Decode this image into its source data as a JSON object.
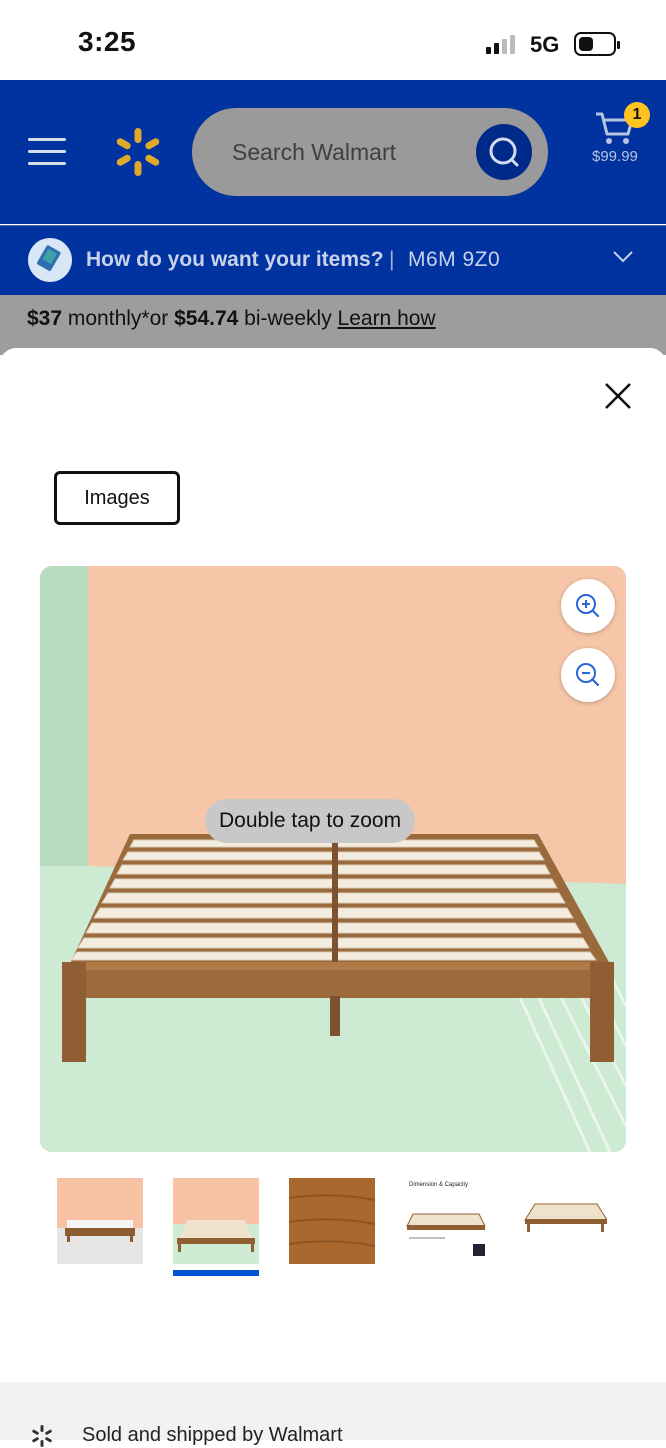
{
  "status_bar": {
    "time": "3:25",
    "network": "5G"
  },
  "header": {
    "search_placeholder": "Search Walmart",
    "cart_count": "1",
    "cart_total": "$99.99",
    "brand_color": "#0033a0",
    "spark_color": "#ffc220"
  },
  "pickup": {
    "question": "How do you want your items?",
    "separator": "|",
    "postal_code": "M6M 9Z0"
  },
  "finance": {
    "monthly_amount": "$37",
    "monthly_text": " monthly*or ",
    "biweekly_amount": "$54.74",
    "biweekly_text": " bi-weekly ",
    "link": "Learn how"
  },
  "viewer": {
    "tab_label": "Images",
    "hint": "Double tap to zoom",
    "zoom_in_icon": "zoom-in-icon",
    "zoom_out_icon": "zoom-out-icon",
    "selected_thumbnail_index": 1,
    "thumbnails": [
      {
        "name": "bed-with-mattress"
      },
      {
        "name": "bed-frame-pink-wall"
      },
      {
        "name": "wood-texture"
      },
      {
        "name": "dimension-capacity",
        "caption": "Dimension & Capacity"
      },
      {
        "name": "bed-frame-angle"
      }
    ]
  },
  "footer": {
    "seller_text": "Sold and shipped by Walmart"
  }
}
